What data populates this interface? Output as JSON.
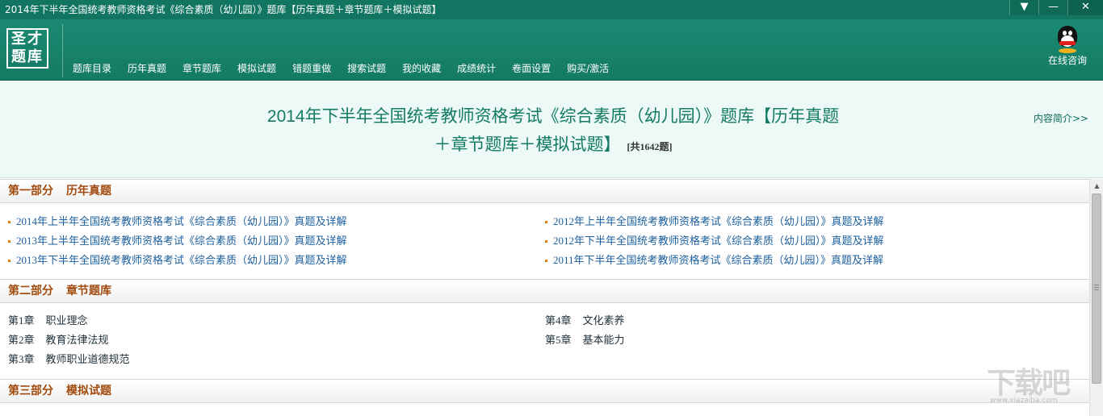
{
  "window": {
    "title": "2014年下半年全国统考教师资格考试《综合素质（幼儿园）》题库【历年真题＋章节题库＋模拟试题】",
    "buttons": {
      "menu": "▼",
      "minimize": "—",
      "close": "✕"
    }
  },
  "header": {
    "logo": [
      "圣才",
      "题库"
    ],
    "nav": [
      "题库目录",
      "历年真题",
      "章节题库",
      "模拟试题",
      "错题重做",
      "搜索试题",
      "我的收藏",
      "成绩统计",
      "卷面设置",
      "购买/激活"
    ],
    "consult_label": "在线咨询",
    "consult_icon": "qq-penguin-icon"
  },
  "banner": {
    "title_line1": "2014年下半年全国统考教师资格考试《综合素质（幼儿园）》题库【历年真题",
    "title_line2": "＋章节题库＋模拟试题】",
    "count": "[共1642题]",
    "intro_link": "内容简介>>"
  },
  "sections": [
    {
      "part": "第一部分",
      "name": "历年真题",
      "left": [
        "2014年上半年全国统考教师资格考试《综合素质（幼儿园）》真题及详解",
        "2013年上半年全国统考教师资格考试《综合素质（幼儿园）》真题及详解",
        "2013年下半年全国统考教师资格考试《综合素质（幼儿园）》真题及详解"
      ],
      "right": [
        "2012年上半年全国统考教师资格考试《综合素质（幼儿园）》真题及详解",
        "2012年下半年全国统考教师资格考试《综合素质（幼儿园）》真题及详解",
        "2011年下半年全国统考教师资格考试《综合素质（幼儿园）》真题及详解"
      ]
    },
    {
      "part": "第二部分",
      "name": "章节题库",
      "left": [
        {
          "num": "第1章",
          "title": "职业理念"
        },
        {
          "num": "第2章",
          "title": "教育法律法规"
        },
        {
          "num": "第3章",
          "title": "教师职业道德规范"
        }
      ],
      "right": [
        {
          "num": "第4章",
          "title": "文化素养"
        },
        {
          "num": "第5章",
          "title": "基本能力"
        }
      ]
    },
    {
      "part": "第三部分",
      "name": "模拟试题"
    }
  ],
  "watermark": {
    "text": "下载吧",
    "url": "www.xiazaiba.com"
  },
  "colors": {
    "brand": "#127561",
    "banner_bg": "#ecf9f7",
    "section_title": "#a14a0e",
    "link": "#1b5f9d"
  }
}
